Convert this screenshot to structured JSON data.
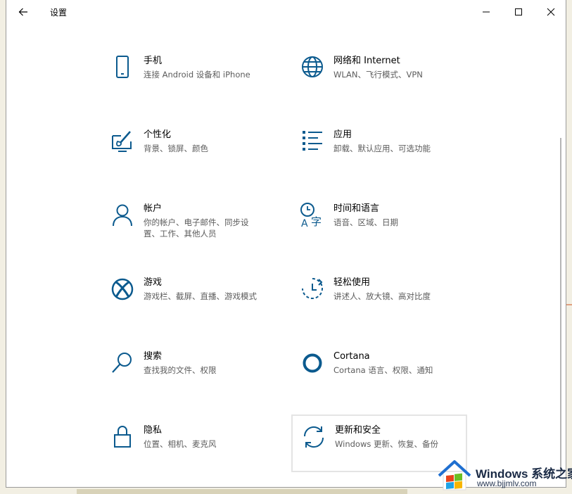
{
  "window": {
    "title": "设置"
  },
  "settings": [
    {
      "name": "手机",
      "desc": "连接 Android 设备和 iPhone",
      "icon": "phone-icon"
    },
    {
      "name": "网络和 Internet",
      "desc": "WLAN、飞行模式、VPN",
      "icon": "globe-icon"
    },
    {
      "name": "个性化",
      "desc": "背景、锁屏、颜色",
      "icon": "personalization-icon"
    },
    {
      "name": "应用",
      "desc": "卸载、默认应用、可选功能",
      "icon": "apps-list-icon"
    },
    {
      "name": "帐户",
      "desc": "你的帐户、电子邮件、同步设置、工作、其他人员",
      "icon": "person-icon"
    },
    {
      "name": "时间和语言",
      "desc": "语音、区域、日期",
      "icon": "time-language-icon"
    },
    {
      "name": "游戏",
      "desc": "游戏栏、截屏、直播、游戏模式",
      "icon": "xbox-icon"
    },
    {
      "name": "轻松使用",
      "desc": "讲述人、放大镜、高对比度",
      "icon": "ease-of-access-icon"
    },
    {
      "name": "搜索",
      "desc": "查找我的文件、权限",
      "icon": "search-icon"
    },
    {
      "name": "Cortana",
      "desc": "Cortana 语言、权限、通知",
      "icon": "cortana-icon"
    },
    {
      "name": "隐私",
      "desc": "位置、相机、麦克风",
      "icon": "lock-icon"
    },
    {
      "name": "更新和安全",
      "desc": "Windows 更新、恢复、备份",
      "icon": "update-sync-icon"
    }
  ],
  "colors": {
    "accent": "#0b5a8e",
    "text": "#000000",
    "secondary_text": "#5c5c5c"
  },
  "watermark": {
    "title": "Windows 系统之家",
    "url": "www.bjjmlv.com"
  }
}
